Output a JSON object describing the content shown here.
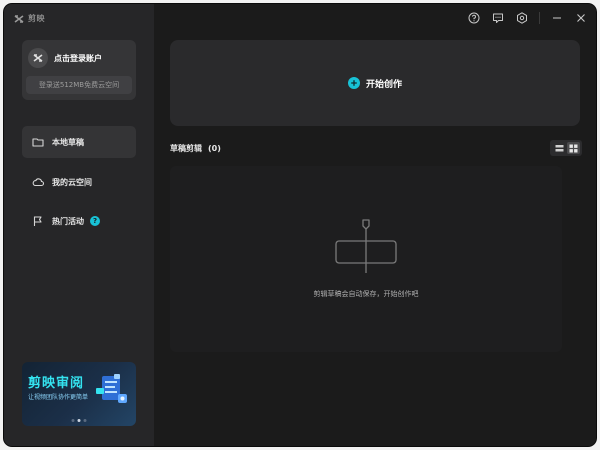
{
  "app": {
    "name": "剪映"
  },
  "titlebar": {
    "icons": [
      "help-icon",
      "feedback-icon",
      "settings-icon",
      "minimize-icon",
      "close-icon"
    ]
  },
  "login": {
    "title": "点击登录账户",
    "subtitle": "登录送512MB免费云空间"
  },
  "nav": {
    "items": [
      {
        "label": "本地草稿",
        "icon": "folder-icon",
        "active": true
      },
      {
        "label": "我的云空间",
        "icon": "cloud-icon",
        "active": false
      },
      {
        "label": "热门活动",
        "icon": "flag-icon",
        "active": false,
        "badge": "?"
      }
    ]
  },
  "banner": {
    "title": "剪映审阅",
    "subtitle": "让视频团队协作更简单",
    "dots": 3,
    "active_dot": 1
  },
  "create": {
    "label": "开始创作"
  },
  "drafts": {
    "title": "草稿剪辑",
    "count": "(0)",
    "empty_text": "剪辑草稿会自动保存，开始创作吧",
    "view_modes": [
      "list-view-icon",
      "grid-view-icon"
    ],
    "active_view": "grid-view-icon"
  },
  "colors": {
    "accent": "#18c2d6",
    "sidebar_bg": "#262628",
    "main_bg": "#1b1b1b"
  }
}
